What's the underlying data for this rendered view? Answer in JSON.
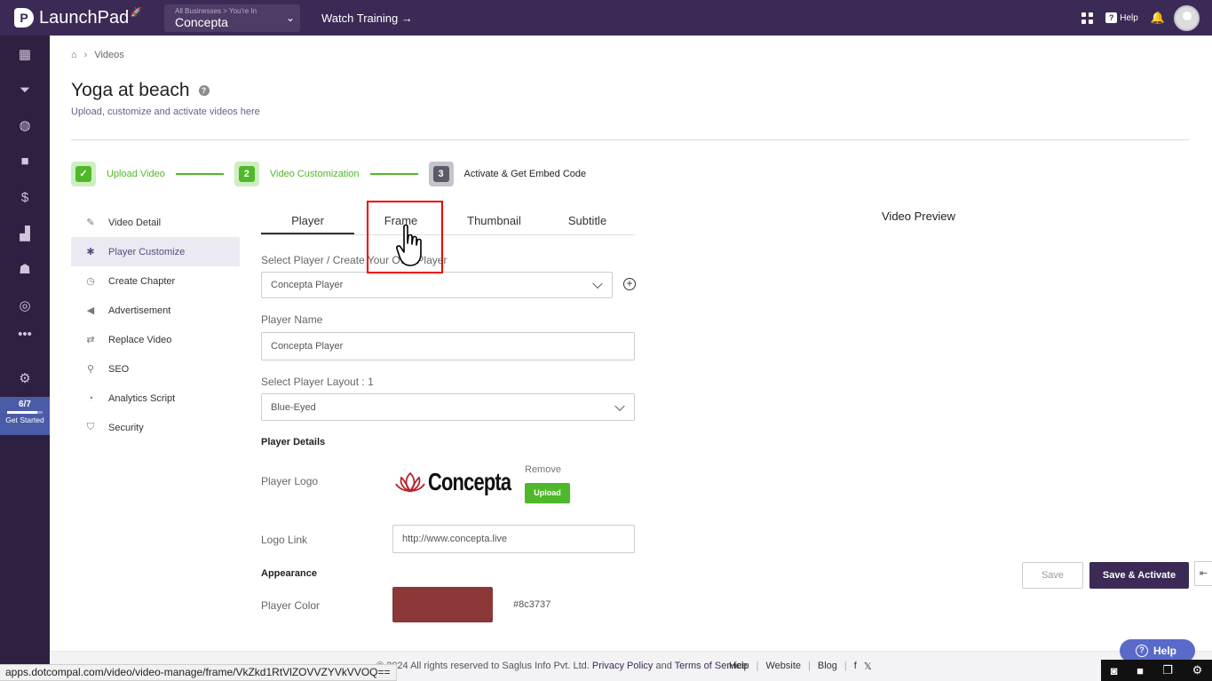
{
  "app": {
    "brand": "LaunchPad",
    "brand_mark": "P",
    "business_caption": "All Businesses > You're In",
    "business_name": "Concepta",
    "watch_training": "Watch Training →",
    "help_label": "Help"
  },
  "rail": {
    "icons": [
      "dashboard-icon",
      "funnel-icon",
      "globe-icon",
      "video-icon",
      "dollar-icon",
      "chart-icon",
      "people-icon",
      "analytics-icon",
      "more-icon",
      "settings-icon"
    ],
    "progress_text": "6/7",
    "progress_fraction": 0.857,
    "progress_label": "Get Started"
  },
  "breadcrumb": {
    "current": "Videos"
  },
  "page": {
    "title": "Yoga at beach",
    "subtitle": "Upload, customize and activate videos here"
  },
  "stepper": [
    {
      "label": "Upload Video",
      "num": "✓"
    },
    {
      "label": "Video Customization",
      "num": "2"
    },
    {
      "label": "Activate & Get Embed Code",
      "num": "3"
    }
  ],
  "menu": [
    {
      "label": "Video Detail",
      "icon": "edit-icon",
      "glyph": "✎"
    },
    {
      "label": "Player Customize",
      "icon": "palette-icon",
      "glyph": "✱"
    },
    {
      "label": "Create Chapter",
      "icon": "timer-icon",
      "glyph": "◷"
    },
    {
      "label": "Advertisement",
      "icon": "megaphone-icon",
      "glyph": "◀"
    },
    {
      "label": "Replace Video",
      "icon": "swap-icon",
      "glyph": "⇄"
    },
    {
      "label": "SEO",
      "icon": "search-icon",
      "glyph": "⚲"
    },
    {
      "label": "Analytics Script",
      "icon": "analytics-icon",
      "glyph": "◔"
    },
    {
      "label": "Security",
      "icon": "shield-icon",
      "glyph": "⛉"
    }
  ],
  "tabs": [
    "Player",
    "Frame",
    "Thumbnail",
    "Subtitle"
  ],
  "form": {
    "select_player_label": "Select Player / Create Your Own Player",
    "select_player_value": "Concepta Player",
    "player_name_label": "Player Name",
    "player_name_value": "Concepta Player",
    "layout_label": "Select Player Layout : 1",
    "layout_value": "Blue-Eyed",
    "details_heading": "Player Details",
    "logo_label": "Player Logo",
    "logo_text": "Concepta",
    "remove_label": "Remove",
    "upload_label": "Upload",
    "logo_link_label": "Logo Link",
    "logo_link_value": "http://www.concepta.live",
    "appearance_heading": "Appearance",
    "color_label": "Player Color",
    "color_value": "#8c3737"
  },
  "preview": {
    "title": "Video Preview"
  },
  "actions": {
    "save": "Save",
    "save_activate": "Save & Activate"
  },
  "footer": {
    "copyright": "© 2024 All rights reserved to Saglus Info Pvt. Ltd.",
    "privacy": "Privacy Policy",
    "and": "and",
    "terms": "Terms of Service",
    "links": [
      "Help",
      "Website",
      "Blog"
    ]
  },
  "status_url": "apps.dotcompal.com/video/video-manage/frame/VkZkd1RtVlZOVVZYVkVVOQ==",
  "help_bubble": "Help",
  "colors": {
    "brand": "#3b2a55",
    "green": "#4fb82a",
    "player_color": "#8c3737"
  }
}
